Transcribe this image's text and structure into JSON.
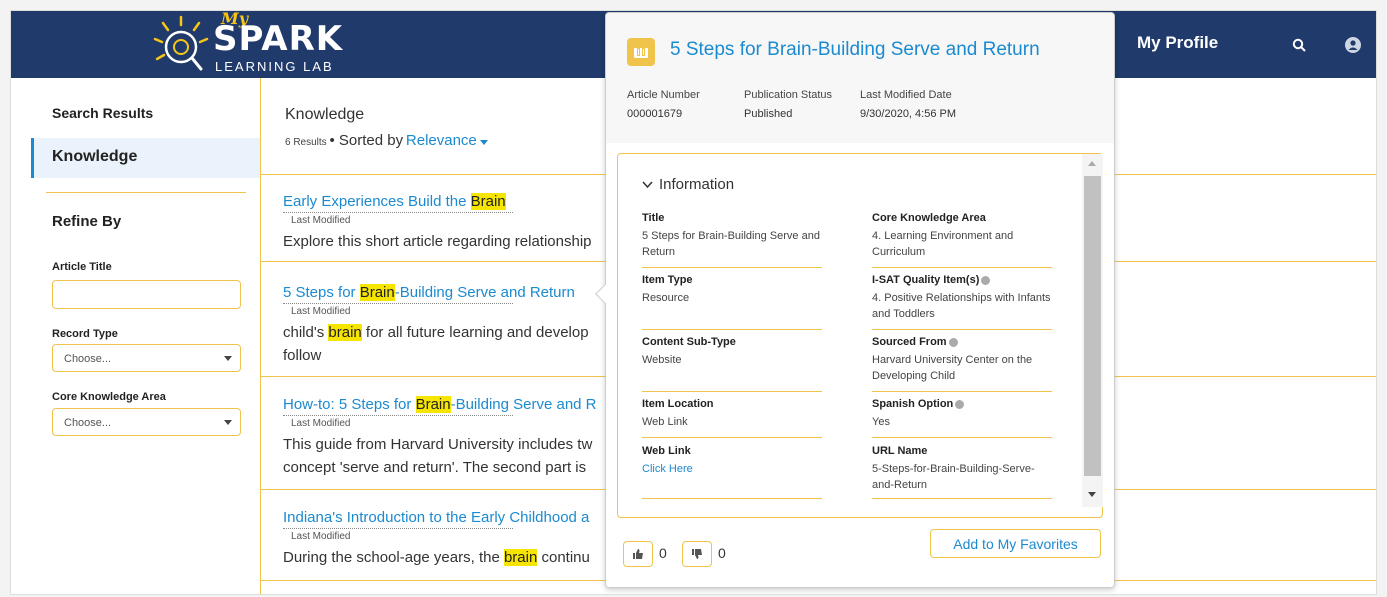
{
  "header": {
    "logo_my": "My",
    "logo_spark": "SPARK",
    "logo_lab": "LEARNING LAB",
    "profile_label": "My Profile",
    "search_icon": "search-icon",
    "avatar_icon": "avatar-icon",
    "bg_color": "#1f3a6b"
  },
  "sidebar": {
    "search_results": "Search Results",
    "knowledge": "Knowledge",
    "refine_by": "Refine By",
    "article_title_label": "Article Title",
    "article_title_value": "",
    "record_type_label": "Record Type",
    "record_type_value": "Choose...",
    "core_area_label": "Core Knowledge Area",
    "core_area_value": "Choose..."
  },
  "main": {
    "heading": "Knowledge",
    "results_count": "6 Results",
    "sorted_by": "Sorted by",
    "sort_value": "Relevance",
    "results": [
      {
        "title_pre": "Early Experiences Build the ",
        "title_hl": "Brain",
        "title_post": "",
        "last_modified": "Last Modified",
        "desc_pre": "Explore this short article regarding relationship",
        "desc_hl": "",
        "desc_post": "",
        "desc2": ""
      },
      {
        "title_pre": "5 Steps for ",
        "title_hl": "Brain",
        "title_post": "-Building Serve and Return",
        "last_modified": "Last Modified",
        "desc_pre": "child's ",
        "desc_hl": "brain",
        "desc_post": " for all future learning and develop",
        "desc2": "follow"
      },
      {
        "title_pre": "How-to: 5 Steps for ",
        "title_hl": "Brain",
        "title_post": "-Building Serve and R",
        "last_modified": "Last Modified",
        "desc_pre": "This guide from Harvard University includes tw",
        "desc_hl": "",
        "desc_post": "",
        "desc2": "concept 'serve and return'. The second part is"
      },
      {
        "title_pre": "Indiana's Introduction to the Early Childhood a",
        "title_hl": "",
        "title_post": "",
        "last_modified": "Last Modified",
        "desc_pre": "During the school-age years, the ",
        "desc_hl": "brain",
        "desc_post": " continu",
        "desc2": ""
      }
    ]
  },
  "popover": {
    "title": "5 Steps for Brain-Building Serve and Return",
    "badge_icon": "knowledge-icon",
    "article_number_label": "Article Number",
    "article_number": "000001679",
    "publication_status_label": "Publication Status",
    "publication_status": "Published",
    "last_modified_label": "Last Modified Date",
    "last_modified": "9/30/2020, 4:56 PM",
    "section_title": "Information",
    "fields": {
      "title_label": "Title",
      "title_value": "5 Steps for Brain-Building Serve and Return",
      "core_area_label": "Core Knowledge Area",
      "core_area_value": "4. Learning Environment and Curriculum",
      "item_type_label": "Item Type",
      "item_type_value": "Resource",
      "isat_label": "I-SAT Quality Item(s)",
      "isat_value": "4. Positive Relationships with Infants and Toddlers",
      "content_subtype_label": "Content Sub-Type",
      "content_subtype_value": "Website",
      "sourced_from_label": "Sourced From",
      "sourced_from_value": "Harvard University Center on the Developing Child",
      "item_location_label": "Item Location",
      "item_location_value": "Web Link",
      "spanish_label": "Spanish Option",
      "spanish_value": "Yes",
      "web_link_label": "Web Link",
      "web_link_value": "Click Here",
      "url_name_label": "URL Name",
      "url_name_value": "5-Steps-for-Brain-Building-Serve-and-Return"
    },
    "upvotes": "0",
    "downvotes": "0",
    "favorites_label": "Add to My Favorites"
  }
}
